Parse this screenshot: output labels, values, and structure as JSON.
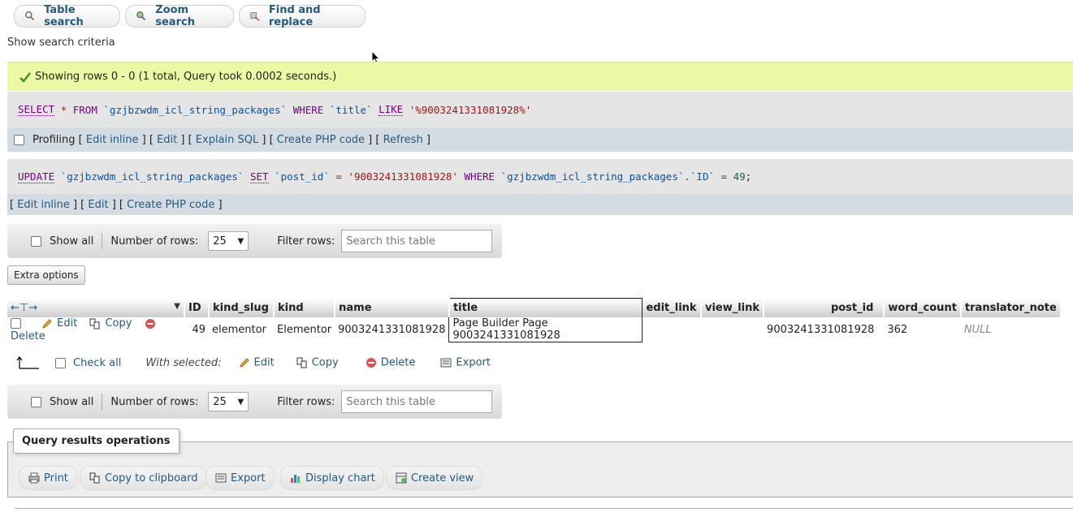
{
  "tabs": [
    {
      "label": "Table search",
      "icon": "search-icon"
    },
    {
      "label": "Zoom search",
      "icon": "zoom-search-icon"
    },
    {
      "label": "Find and replace",
      "icon": "find-replace-icon"
    }
  ],
  "show_criteria": "Show search criteria",
  "success_message": "Showing rows 0 - 0 (1 total, Query took 0.0002 seconds.)",
  "select_query": {
    "k1": "SELECT",
    "star": "*",
    "k2": "FROM",
    "table": "`gzjbzwdm_icl_string_packages`",
    "k3": "WHERE",
    "col": "`title`",
    "k4": "LIKE",
    "val": "'%9003241331081928%'"
  },
  "profiling": {
    "label": "Profiling",
    "links": [
      "Edit inline",
      "Edit",
      "Explain SQL",
      "Create PHP code",
      "Refresh"
    ]
  },
  "update_query": {
    "k1": "UPDATE",
    "table": "`gzjbzwdm_icl_string_packages`",
    "k2": "SET",
    "col": "`post_id`",
    "eq": "=",
    "val": "'9003241331081928'",
    "k3": "WHERE",
    "tcol": "`gzjbzwdm_icl_string_packages`.`ID`",
    "eq2": "=",
    "num": "49",
    "semi": ";"
  },
  "update_links": [
    "Edit inline",
    "Edit",
    "Create PHP code"
  ],
  "nav": {
    "show_all": "Show all",
    "num_rows_label": "Number of rows:",
    "num_rows_value": "25",
    "filter_label": "Filter rows:",
    "filter_placeholder": "Search this table"
  },
  "extra_options": "Extra options",
  "table": {
    "columns": [
      "ID",
      "kind_slug",
      "kind",
      "name",
      "title",
      "edit_link",
      "view_link",
      "post_id",
      "word_count",
      "translator_note"
    ],
    "row": {
      "edit": "Edit",
      "copy": "Copy",
      "delete": "Delete",
      "ID": "49",
      "kind_slug": "elementor",
      "kind": "Elementor",
      "name": "9003241331081928",
      "title": "Page Builder Page 9003241331081928",
      "edit_link": "",
      "view_link": "",
      "post_id": "9003241331081928",
      "word_count": "362",
      "translator_note": "NULL"
    }
  },
  "bulk": {
    "check_all": "Check all",
    "with_selected": "With selected:",
    "edit": "Edit",
    "copy": "Copy",
    "delete": "Delete",
    "export": "Export"
  },
  "ops": {
    "title": "Query results operations",
    "buttons": [
      "Print",
      "Copy to clipboard",
      "Export",
      "Display chart",
      "Create view"
    ]
  },
  "colors": {
    "accent": "#235a81",
    "success_bg": "#ebf8a4",
    "delete_red": "#d9534f"
  }
}
